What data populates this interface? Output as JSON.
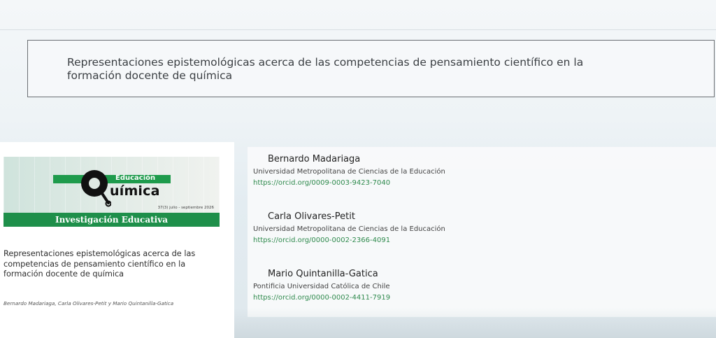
{
  "article": {
    "title": "Representaciones epistemológicas acerca de las competencias de pensamiento científico en la formación docente de química"
  },
  "cover": {
    "logo_text": {
      "edu": "Educación",
      "quimica": "uímica"
    },
    "issue": "37(3) julio - septiembre 2026",
    "section": "Investigación Educativa",
    "title": "Representaciones epistemológicas acerca de las competencias de pensamiento científico en la formación docente de química",
    "authors": "Bernardo Madariaga, Carla Olivares-Petit y Mario Quintanilla-Gatica"
  },
  "authors": [
    {
      "name": "Bernardo Madariaga",
      "affiliation": "Universidad Metropolitana de Ciencias de la Educación",
      "orcid": "https://orcid.org/0009-0003-9423-7040"
    },
    {
      "name": "Carla Olivares-Petit",
      "affiliation": "Universidad Metropolitana de Ciencias de la Educación",
      "orcid": "https://orcid.org/0000-0002-2366-4091"
    },
    {
      "name": "Mario Quintanilla-Gatica",
      "affiliation": "Pontificia Universidad Católica de Chile",
      "orcid": "https://orcid.org/0000-0002-4411-7919"
    }
  ],
  "colors": {
    "accent_green": "#1e9b4c",
    "link_green": "#2f8a4d",
    "border": "#6b6f73"
  }
}
